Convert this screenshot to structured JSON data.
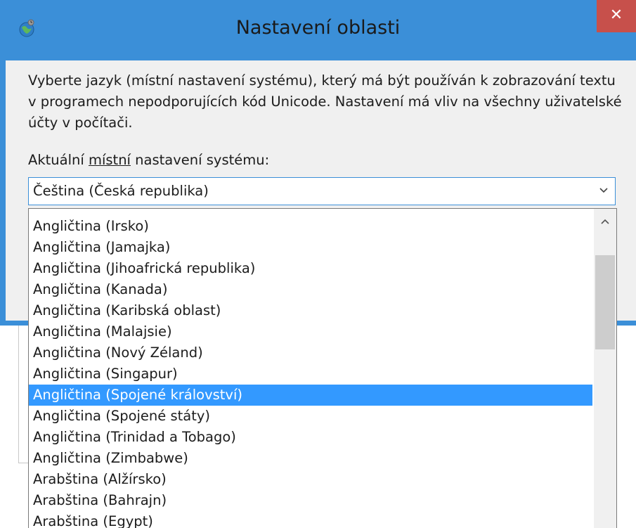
{
  "window": {
    "title": "Nastavení oblasti",
    "close_label": "✕"
  },
  "content": {
    "description": "Vyberte jazyk (místní nastavení systému), který má být používán k zobrazování textu v programech nepodporujících kód Unicode. Nastavení má vliv na všechny uživatelské účty v počítači.",
    "label_prefix": "Aktuální ",
    "label_underlined": "místní",
    "label_suffix": " nastavení systému:"
  },
  "combo": {
    "value": "Čeština (Česká republika)"
  },
  "dropdown": {
    "items": [
      {
        "label": "Angličtina (Irsko)",
        "selected": false
      },
      {
        "label": "Angličtina (Jamajka)",
        "selected": false
      },
      {
        "label": "Angličtina (Jihoafrická republika)",
        "selected": false
      },
      {
        "label": "Angličtina (Kanada)",
        "selected": false
      },
      {
        "label": "Angličtina (Karibská oblast)",
        "selected": false
      },
      {
        "label": "Angličtina (Malajsie)",
        "selected": false
      },
      {
        "label": "Angličtina (Nový Zéland)",
        "selected": false
      },
      {
        "label": "Angličtina (Singapur)",
        "selected": false
      },
      {
        "label": "Angličtina (Spojené království)",
        "selected": true
      },
      {
        "label": "Angličtina (Spojené státy)",
        "selected": false
      },
      {
        "label": "Angličtina (Trinidad a Tobago)",
        "selected": false
      },
      {
        "label": "Angličtina (Zimbabwe)",
        "selected": false
      },
      {
        "label": "Arabština (Alžírsko)",
        "selected": false
      },
      {
        "label": "Arabština (Bahrajn)",
        "selected": false
      },
      {
        "label": "Arabština (Egypt)",
        "selected": false
      }
    ]
  },
  "colors": {
    "frame": "#3b8fd8",
    "close": "#c7504b",
    "selection": "#3399ff"
  }
}
